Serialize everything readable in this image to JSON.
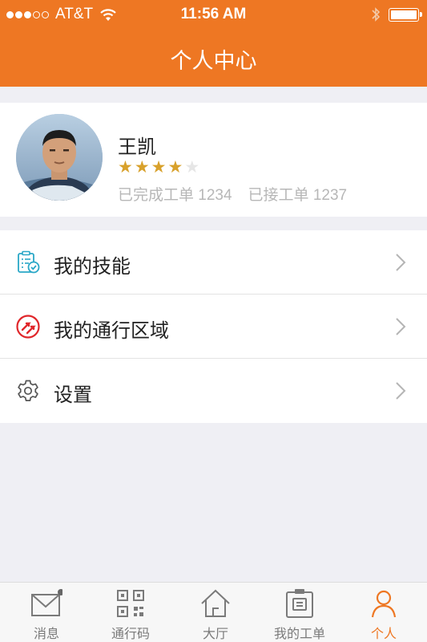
{
  "status_bar": {
    "carrier": "AT&T",
    "time": "11:56 AM"
  },
  "header": {
    "title": "个人中心"
  },
  "profile": {
    "name": "王凯",
    "rating": 4,
    "rating_max": 5,
    "completed_orders": "已完成工单 1234",
    "accepted_orders": "已接工单 1237"
  },
  "menu": {
    "items": [
      {
        "label": "我的技能",
        "icon": "skills-document-icon"
      },
      {
        "label": "我的通行区域",
        "icon": "pass-area-icon"
      },
      {
        "label": "设置",
        "icon": "gear-icon"
      }
    ]
  },
  "tabbar": {
    "tabs": [
      {
        "label": "消息",
        "icon": "message-envelope-icon"
      },
      {
        "label": "通行码",
        "icon": "qr-code-icon"
      },
      {
        "label": "大厅",
        "icon": "home-icon"
      },
      {
        "label": "我的工单",
        "icon": "work-order-icon"
      },
      {
        "label": "个人",
        "icon": "person-icon"
      }
    ],
    "active_index": 4
  },
  "colors": {
    "accent": "#ee7723",
    "star": "#d8a12b",
    "pass_area_icon": "#e0272b",
    "skills_icon": "#2aa7c7"
  }
}
